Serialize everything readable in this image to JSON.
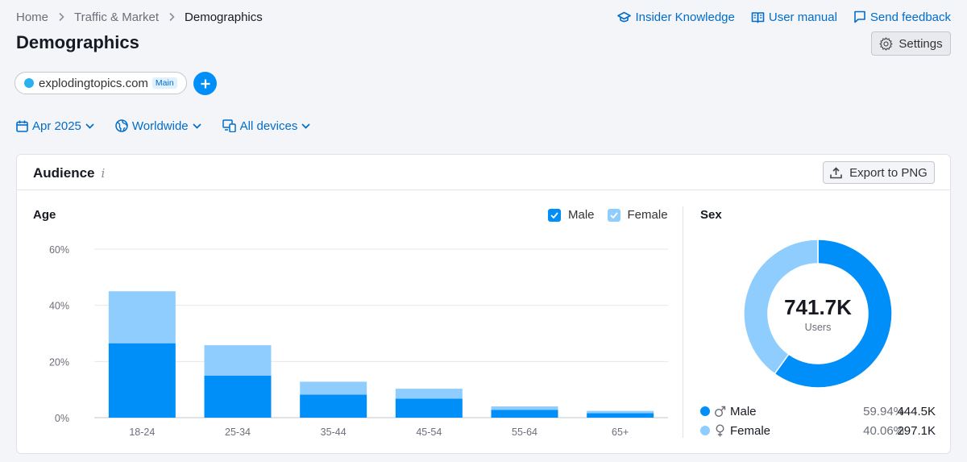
{
  "breadcrumb": [
    "Home",
    "Traffic & Market",
    "Demographics"
  ],
  "page_title": "Demographics",
  "top_links": [
    "Insider Knowledge",
    "User manual",
    "Send feedback"
  ],
  "settings_label": "Settings",
  "domain": {
    "name": "explodingtopics.com",
    "badge": "Main",
    "dot_color": "#2bb1f0"
  },
  "filters": {
    "date": "Apr 2025",
    "region": "Worldwide",
    "devices": "All devices"
  },
  "card": {
    "title": "Audience",
    "info_icon": "i",
    "export_label": "Export to PNG"
  },
  "colors": {
    "male": "#008ff8",
    "female": "#8fcdff",
    "accent": "#006dca"
  },
  "age": {
    "title": "Age",
    "legend": {
      "male": "Male",
      "female": "Female"
    }
  },
  "sex": {
    "title": "Sex",
    "total": "741.7K",
    "total_label": "Users",
    "male": {
      "label": "Male",
      "pct": "59.94%",
      "count": "444.5K"
    },
    "female": {
      "label": "Female",
      "pct": "40.06%",
      "count": "297.1K"
    }
  },
  "chart_data": [
    {
      "type": "bar",
      "stacked": true,
      "title": "Age",
      "categories": [
        "18-24",
        "25-34",
        "35-44",
        "45-54",
        "55-64",
        "65+"
      ],
      "series": [
        {
          "name": "Male",
          "values": [
            26.5,
            15.0,
            8.2,
            6.8,
            2.8,
            1.6
          ]
        },
        {
          "name": "Female",
          "values": [
            18.5,
            10.8,
            4.6,
            3.5,
            1.2,
            0.8
          ]
        }
      ],
      "yticks": [
        "0%",
        "20%",
        "40%",
        "60%"
      ],
      "ylim": [
        0,
        60
      ],
      "grid": true,
      "legend_position": "top-right"
    },
    {
      "type": "pie",
      "donut": true,
      "title": "Sex",
      "categories": [
        "Male",
        "Female"
      ],
      "values": [
        59.94,
        40.06
      ]
    }
  ]
}
